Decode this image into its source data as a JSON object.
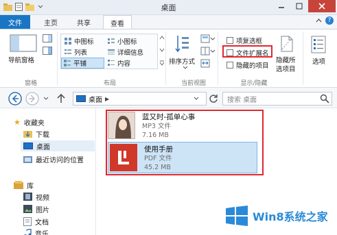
{
  "window": {
    "title": "桌面"
  },
  "tabs": [
    {
      "label": "文件"
    },
    {
      "label": "主页"
    },
    {
      "label": "共享"
    },
    {
      "label": "查看"
    }
  ],
  "ribbon": {
    "nav_pane_label": "导航窗格",
    "pane_group": "窗格",
    "layout_group": "布局",
    "layout_options": [
      "中图标",
      "小图标",
      "列表",
      "详细信息",
      "平铺",
      "内容"
    ],
    "sort_label": "排序方式",
    "current_view_group": "当前视图",
    "show_hide_group": "显示/隐藏",
    "checkboxes": [
      {
        "label": "项复选框",
        "checked": false
      },
      {
        "label": "文件扩展名",
        "checked": false
      },
      {
        "label": "隐藏的项目",
        "checked": false
      }
    ],
    "hide_selected_label_1": "隐藏所",
    "hide_selected_label_2": "选项目",
    "options_label": "选项"
  },
  "address": {
    "location": "桌面",
    "search_placeholder": "搜索 桌面"
  },
  "nav": {
    "favorites": "收藏夹",
    "downloads": "下载",
    "desktop": "桌面",
    "recent": "最近访问的位置",
    "libraries": "库",
    "videos": "视频",
    "pictures": "图片",
    "documents": "文档",
    "music": "音乐"
  },
  "files": [
    {
      "name": "蓝又时-孤单心事",
      "type": "MP3 文件",
      "size": "7.16 MB"
    },
    {
      "name": "使用手册",
      "type": "PDF 文件",
      "size": "45.2 MB"
    }
  ],
  "watermark": {
    "text": "Win8系统之家"
  },
  "colors": {
    "accent": "#1a76c4",
    "highlight": "#e0262e",
    "pdf_red": "#d0382a",
    "selection": "#cde4f7"
  }
}
